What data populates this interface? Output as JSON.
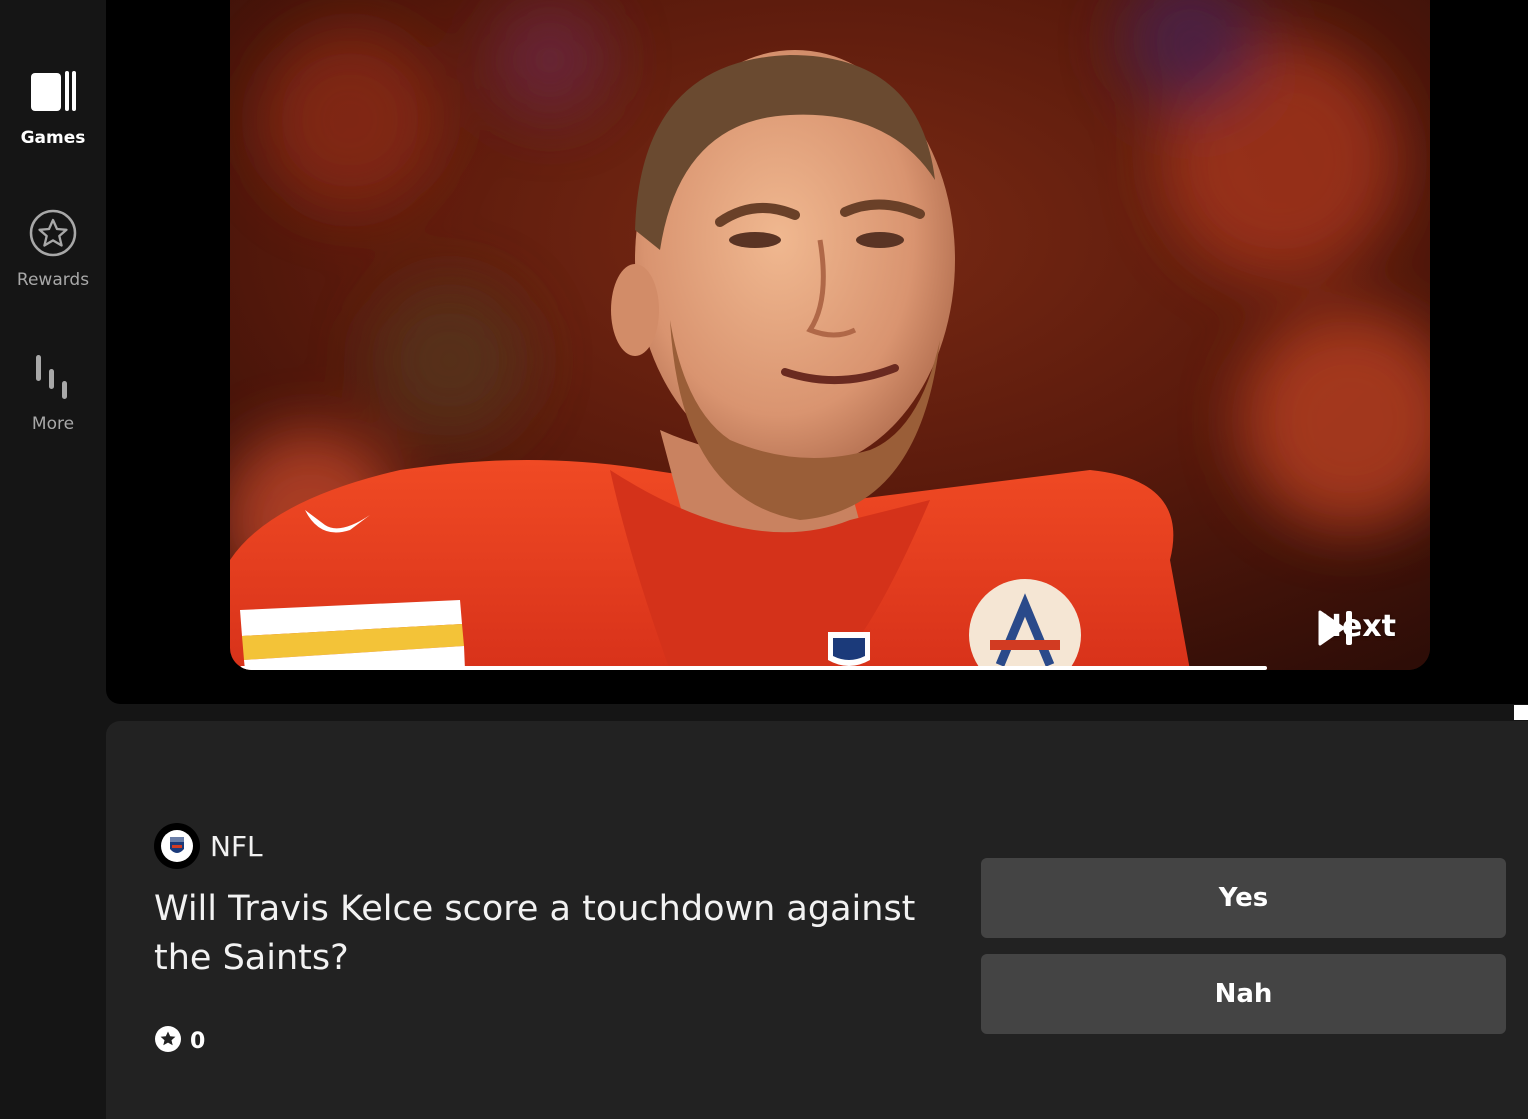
{
  "sidebar": {
    "items": [
      {
        "label": "Games",
        "icon": "games-icon",
        "active": true
      },
      {
        "label": "Rewards",
        "icon": "star-badge-icon",
        "active": false
      },
      {
        "label": "More",
        "icon": "more-bars-icon",
        "active": false
      }
    ]
  },
  "media": {
    "next_label": "Next",
    "next_icon": "skip-next-icon",
    "progress": 0.87
  },
  "question_card": {
    "league": "NFL",
    "league_logo": "nfl-shield-logo",
    "question": "Will Travis Kelce score a touchdown against the Saints?",
    "points": "0",
    "points_icon": "star-coin-icon",
    "answers": [
      "Yes",
      "Nah"
    ]
  },
  "colors": {
    "background": "#151515",
    "panel": "#222222",
    "button": "#444444",
    "jersey_red": "#e8381c",
    "jersey_yellow": "#f3c338"
  }
}
